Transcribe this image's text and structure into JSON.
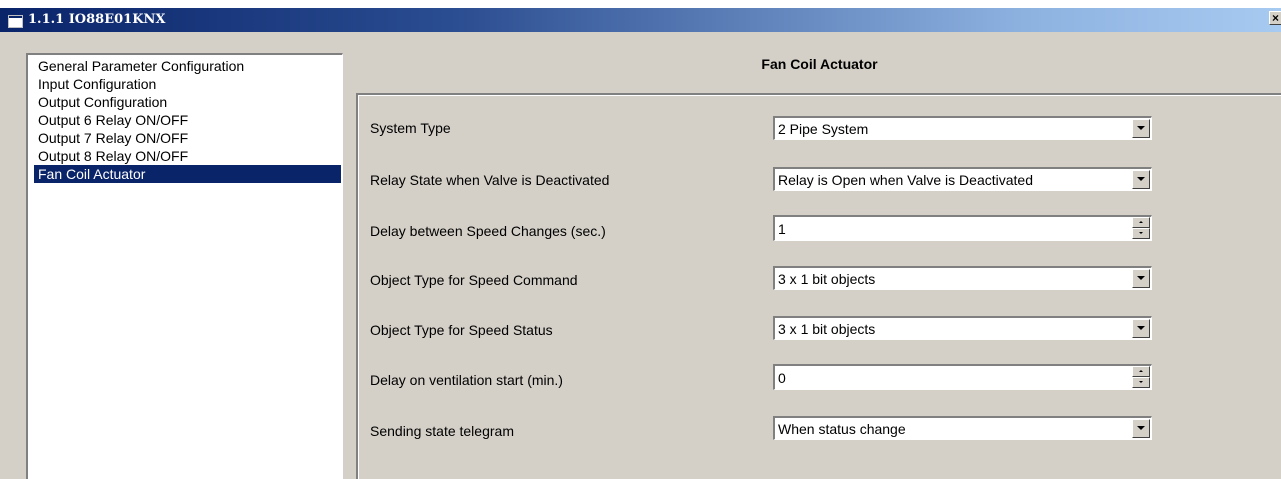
{
  "window": {
    "title": "1.1.1 IO88E01KNX",
    "close_label": "×"
  },
  "nav": {
    "items": [
      {
        "label": "General Parameter Configuration",
        "selected": false
      },
      {
        "label": "Input Configuration",
        "selected": false
      },
      {
        "label": "Output Configuration",
        "selected": false
      },
      {
        "label": "Output 6 Relay ON/OFF",
        "selected": false
      },
      {
        "label": "Output 7 Relay ON/OFF",
        "selected": false
      },
      {
        "label": "Output 8 Relay ON/OFF",
        "selected": false
      },
      {
        "label": "Fan Coil Actuator",
        "selected": true
      }
    ]
  },
  "panel": {
    "title": "Fan Coil Actuator",
    "params": [
      {
        "label": "System Type",
        "control": "combo",
        "value": "2 Pipe System"
      },
      {
        "label": "Relay State when Valve is Deactivated",
        "control": "combo",
        "value": "Relay is Open when Valve is Deactivated"
      },
      {
        "label": "Delay between Speed Changes (sec.)",
        "control": "spin",
        "value": "1"
      },
      {
        "label": "Object Type for Speed Command",
        "control": "combo",
        "value": "3 x 1 bit objects"
      },
      {
        "label": "Object Type for Speed Status",
        "control": "combo",
        "value": "3 x 1 bit objects"
      },
      {
        "label": "Delay on ventilation start (min.)",
        "control": "spin",
        "value": "0"
      },
      {
        "label": "Sending state telegram",
        "control": "combo",
        "value": "When status change"
      }
    ]
  },
  "colors": {
    "titlebar_start": "#0a246a",
    "titlebar_end": "#a6caf0",
    "selection": "#0a246a",
    "face": "#d4d0c8"
  }
}
